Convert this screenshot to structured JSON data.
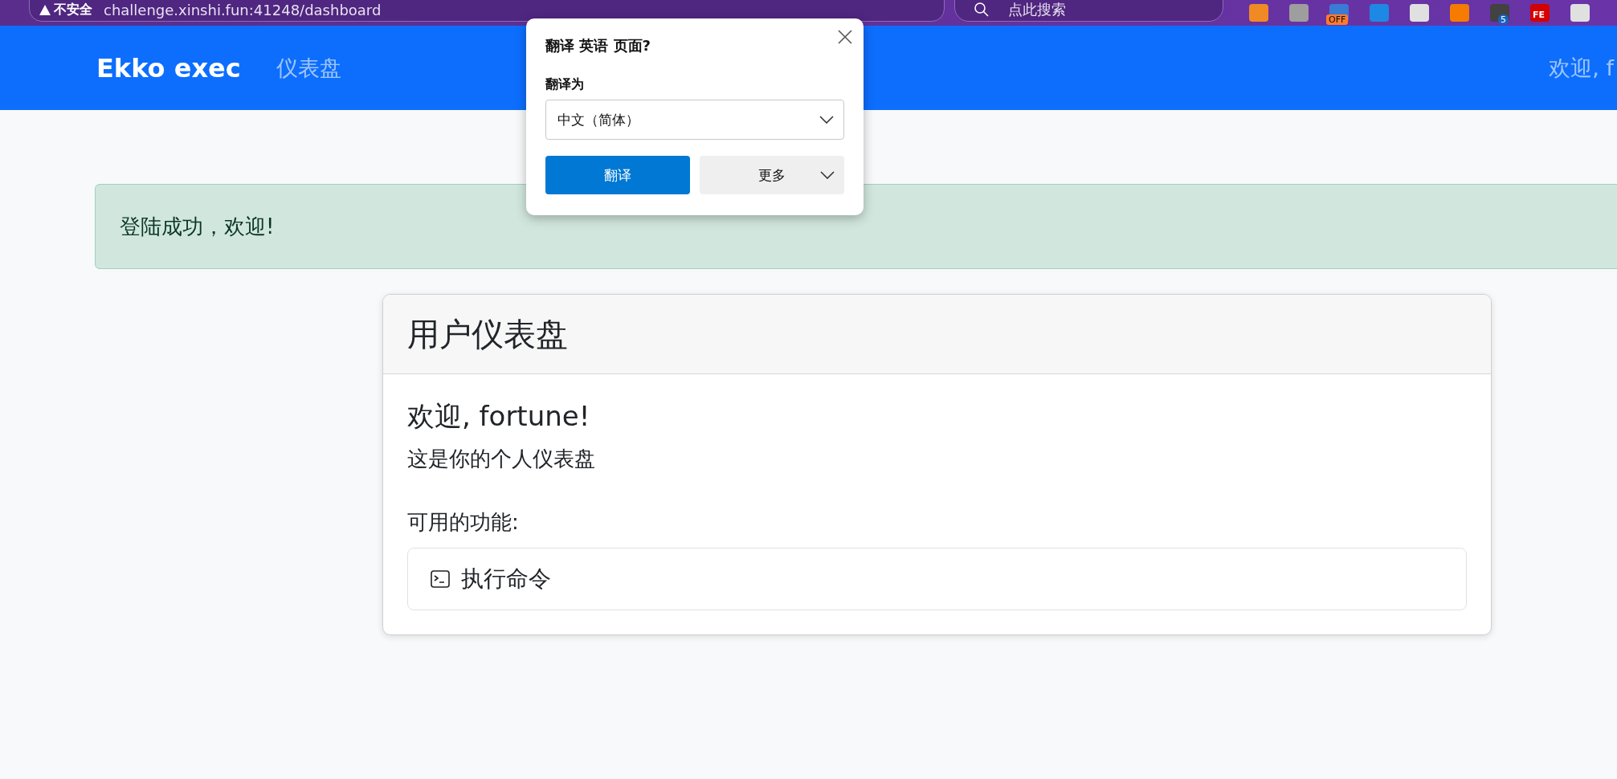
{
  "browser": {
    "security": "不安全",
    "url": "challenge.xinshi.fun:41248/dashboard",
    "search_placeholder": "点此搜索",
    "extensions": [
      {
        "kind": "plain"
      },
      {
        "kind": "plain"
      },
      {
        "kind": "badge",
        "badge": "OFF"
      },
      {
        "kind": "plain"
      },
      {
        "kind": "plain"
      },
      {
        "kind": "plain"
      },
      {
        "kind": "badge",
        "badge": "5"
      },
      {
        "kind": "label",
        "badge": "FE"
      },
      {
        "kind": "plain"
      }
    ]
  },
  "navbar": {
    "brand": "Ekko exec",
    "links": [
      {
        "label": "仪表盘",
        "selected": false
      }
    ],
    "greeting": "欢迎, f"
  },
  "alert": {
    "text": "登陆成功，欢迎!"
  },
  "card": {
    "title": "用户仪表盘",
    "welcome": "欢迎, fortune!",
    "subtitle": "这是你的个人仪表盘",
    "features_label": "可用的功能:",
    "features": [
      {
        "label": "执行命令"
      }
    ]
  },
  "translate_popup": {
    "title": "翻译 英语 页面?",
    "target_label": "翻译为",
    "target_value": "中文（简体）",
    "buttons": [
      {
        "label": "翻译",
        "kind": "primary"
      },
      {
        "label": "更多",
        "kind": "menu"
      }
    ]
  }
}
